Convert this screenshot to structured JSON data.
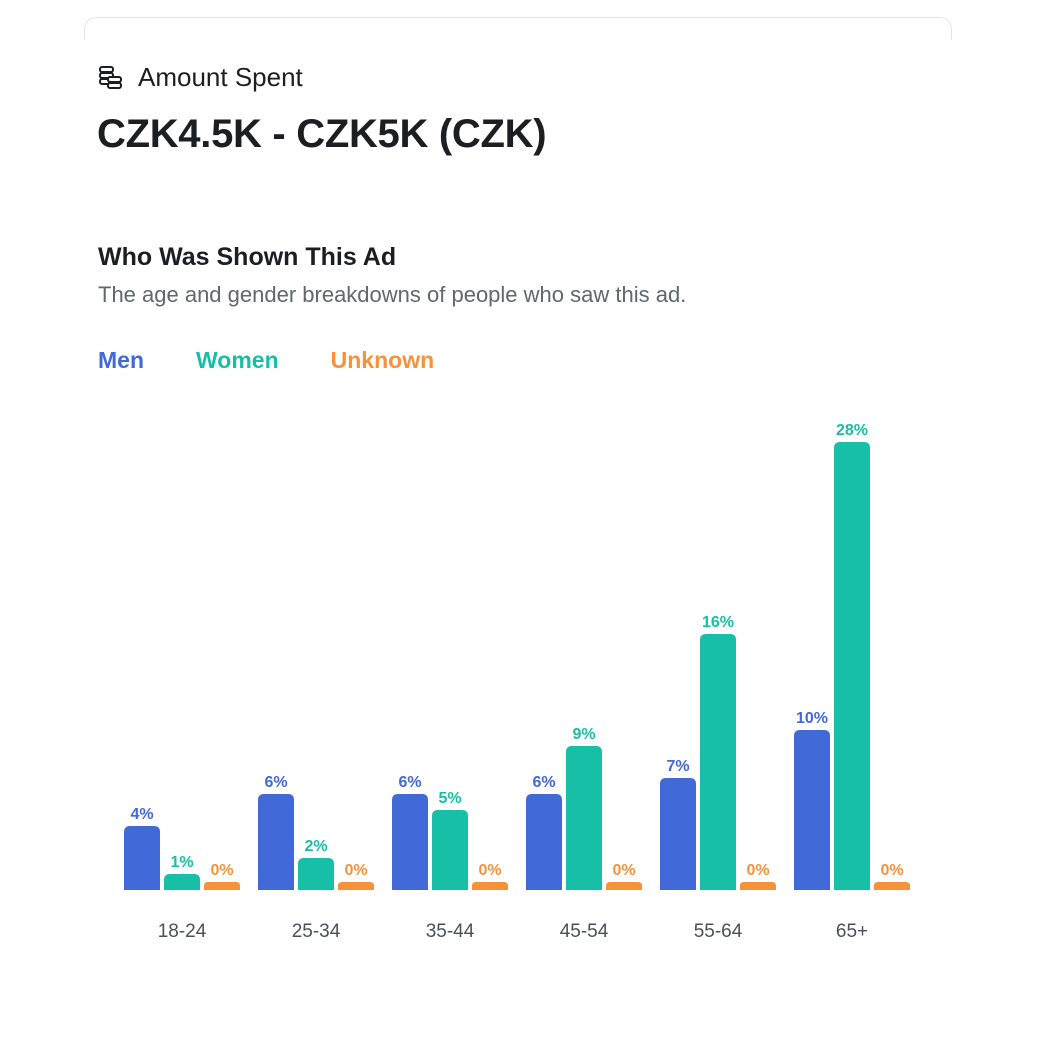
{
  "amount": {
    "icon": "coins-stack-icon",
    "label": "Amount Spent",
    "value": "CZK4.5K - CZK5K (CZK)"
  },
  "audience": {
    "title": "Who Was Shown This Ad",
    "subtitle": "The age and gender breakdowns of people who saw this ad."
  },
  "legend": {
    "men": "Men",
    "women": "Women",
    "unknown": "Unknown"
  },
  "colors": {
    "men": "#4169d8",
    "women": "#16bfa6",
    "unknown": "#f7923a",
    "text": "#1c1e21",
    "subtext": "#606770",
    "tick": "#4b4f56"
  },
  "chart_data": {
    "type": "bar",
    "categories": [
      "18-24",
      "25-34",
      "35-44",
      "45-54",
      "55-64",
      "65+"
    ],
    "series": [
      {
        "name": "Men",
        "values": [
          4,
          6,
          6,
          6,
          7,
          10
        ],
        "labels": [
          "4%",
          "6%",
          "6%",
          "6%",
          "7%",
          "10%"
        ]
      },
      {
        "name": "Women",
        "values": [
          1,
          2,
          5,
          9,
          16,
          28
        ],
        "labels": [
          "1%",
          "2%",
          "5%",
          "9%",
          "16%",
          "28%"
        ]
      },
      {
        "name": "Unknown",
        "values": [
          0,
          0,
          0,
          0,
          0,
          0
        ],
        "labels": [
          "0%",
          "0%",
          "0%",
          "0%",
          "0%",
          "0%"
        ]
      }
    ],
    "ylim": [
      0,
      28
    ],
    "grid": false,
    "legend_position": "top-left"
  }
}
